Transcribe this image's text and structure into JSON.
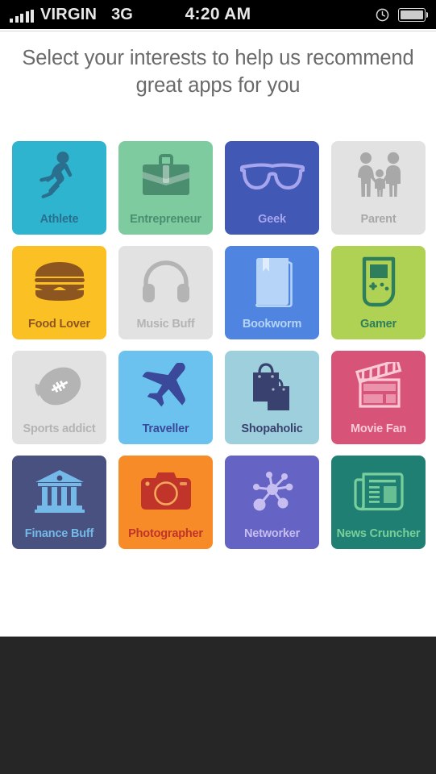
{
  "status_bar": {
    "signal_icon": "signal-bars-icon",
    "carrier": "VIRGIN",
    "network": "3G",
    "time": "4:20 AM",
    "alarm_icon": "clock-icon",
    "battery_icon": "battery-icon"
  },
  "heading": {
    "text": "Select your interests to help us recommend great apps for you"
  },
  "grid": {
    "tiles": [
      {
        "label": "Athlete",
        "icon": "runner-icon",
        "bg": "#2fb4cf",
        "fg": "#2a6f8e",
        "selected": true
      },
      {
        "label": "Entrepreneur",
        "icon": "briefcase-icon",
        "bg": "#7ecba0",
        "fg": "#4b8e6f",
        "selected": true
      },
      {
        "label": "Geek",
        "icon": "glasses-icon",
        "bg": "#4258b5",
        "fg": "#a7a5ee",
        "selected": true
      },
      {
        "label": "Parent",
        "icon": "family-icon",
        "bg": "#e2e2e2",
        "fg": "#a8a8a8",
        "selected": false
      },
      {
        "label": "Food Lover",
        "icon": "burger-icon",
        "bg": "#fbc024",
        "fg": "#8d5620",
        "selected": true
      },
      {
        "label": "Music Buff",
        "icon": "headphones-icon",
        "bg": "#e2e2e2",
        "fg": "#b4b4b4",
        "selected": false
      },
      {
        "label": "Bookworm",
        "icon": "book-icon",
        "bg": "#4f84e0",
        "fg": "#b5d4f7",
        "selected": true
      },
      {
        "label": "Gamer",
        "icon": "handheld-console-icon",
        "bg": "#afd255",
        "fg": "#2e7d5b",
        "selected": true
      },
      {
        "label": "Sports addict",
        "icon": "football-icon",
        "bg": "#e2e2e2",
        "fg": "#b4b4b4",
        "selected": false
      },
      {
        "label": "Traveller",
        "icon": "airplane-icon",
        "bg": "#6cc2ef",
        "fg": "#3a499a",
        "selected": true
      },
      {
        "label": "Shopaholic",
        "icon": "shopping-bags-icon",
        "bg": "#9ecfdd",
        "fg": "#39426e",
        "selected": true
      },
      {
        "label": "Movie Fan",
        "icon": "clapperboard-icon",
        "bg": "#d75377",
        "fg": "#f9c9d6",
        "selected": true
      },
      {
        "label": "Finance Buff",
        "icon": "bank-icon",
        "bg": "#48517f",
        "fg": "#74b9e8",
        "selected": true
      },
      {
        "label": "Photographer",
        "icon": "camera-icon",
        "bg": "#f68b28",
        "fg": "#c0342a",
        "selected": true
      },
      {
        "label": "Networker",
        "icon": "network-icon",
        "bg": "#6563c4",
        "fg": "#c6bdf0",
        "selected": true
      },
      {
        "label": "News Cruncher",
        "icon": "newspaper-icon",
        "bg": "#1f7f72",
        "fg": "#79cf9b",
        "selected": true
      }
    ]
  },
  "bottom_bar": {
    "color": "#262626"
  }
}
